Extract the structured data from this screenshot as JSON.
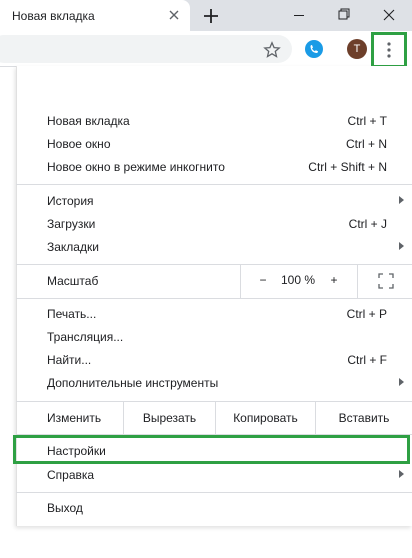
{
  "browser": {
    "tab_title": "Новая вкладка",
    "avatar_letter": "T",
    "accent_color": "#2ea043"
  },
  "menu": {
    "group1": [
      {
        "label": "Новая вкладка",
        "shortcut": "Ctrl + T"
      },
      {
        "label": "Новое окно",
        "shortcut": "Ctrl + N"
      },
      {
        "label": "Новое окно в режиме инкогнито",
        "shortcut": "Ctrl + Shift + N"
      }
    ],
    "group2": [
      {
        "label": "История",
        "shortcut": "",
        "submenu": true
      },
      {
        "label": "Загрузки",
        "shortcut": "Ctrl + J"
      },
      {
        "label": "Закладки",
        "shortcut": "",
        "submenu": true
      }
    ],
    "zoom": {
      "label": "Масштаб",
      "minus": "−",
      "value": "100 %",
      "plus": "+"
    },
    "group3": [
      {
        "label": "Печать...",
        "shortcut": "Ctrl + P"
      },
      {
        "label": "Трансляция...",
        "shortcut": ""
      },
      {
        "label": "Найти...",
        "shortcut": "Ctrl + F"
      },
      {
        "label": "Дополнительные инструменты",
        "shortcut": "",
        "submenu": true
      }
    ],
    "edit": {
      "label": "Изменить",
      "cut": "Вырезать",
      "copy": "Копировать",
      "paste": "Вставить"
    },
    "group4": [
      {
        "label": "Настройки",
        "shortcut": ""
      },
      {
        "label": "Справка",
        "shortcut": "",
        "submenu": true
      }
    ],
    "exit": {
      "label": "Выход"
    }
  }
}
